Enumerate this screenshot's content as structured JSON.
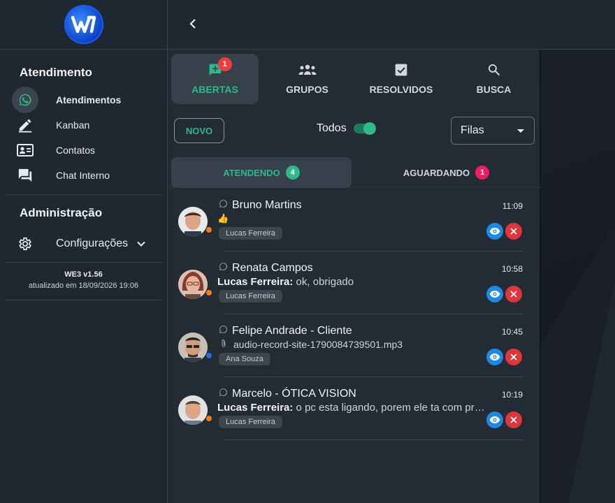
{
  "logo": {
    "text": "W"
  },
  "topbar": {
    "back_icon": "chevron-left-icon"
  },
  "sidebar": {
    "section1": "Atendimento",
    "items": [
      {
        "label": "Atendimentos",
        "icon": "whatsapp-icon",
        "active": true
      },
      {
        "label": "Kanban",
        "icon": "pencil-icon"
      },
      {
        "label": "Contatos",
        "icon": "contacts-card-icon"
      },
      {
        "label": "Chat Interno",
        "icon": "forum-icon"
      }
    ],
    "section2": "Administração",
    "settings": {
      "label": "Configurações",
      "icon": "gear-icon",
      "expand_icon": "chevron-down-icon"
    },
    "version": "WE3 v1.56",
    "updated": "atualizado em 18/09/2026 19:06"
  },
  "tabs": [
    {
      "label": "ABERTAS",
      "icon": "add-chat-icon",
      "badge": "1",
      "active": true
    },
    {
      "label": "GRUPOS",
      "icon": "groups-icon"
    },
    {
      "label": "RESOLVIDOS",
      "icon": "checkbox-icon"
    },
    {
      "label": "BUSCA",
      "icon": "search-icon"
    }
  ],
  "controls": {
    "novo": "NOVO",
    "toggle_label": "Todos",
    "toggle_on": true,
    "select_value": "Filas"
  },
  "subtabs": [
    {
      "label": "ATENDENDO",
      "count": "4",
      "active": true
    },
    {
      "label": "AGUARDANDO",
      "count": "1"
    }
  ],
  "tickets": [
    {
      "name": "Bruno Martins",
      "time": "11:09",
      "sender": "",
      "message": "👍",
      "tag": "Lucas Ferreira",
      "status_color": "#f07d1e",
      "avatar_bg": "#c99a80"
    },
    {
      "name": "Renata Campos",
      "time": "10:58",
      "sender": "Lucas Ferreira:",
      "message": " ok, obrigado",
      "tag": "Lucas Ferreira",
      "status_color": "#f07d1e",
      "avatar_bg": "#b07a6a"
    },
    {
      "name": "Felipe Andrade - Cliente",
      "time": "10:45",
      "sender": "",
      "message": "audio-record-site-1790084739501.mp3",
      "attachment": true,
      "tag": "Ana Souza",
      "status_color": "#1e6fe0",
      "avatar_bg": "#9c7a6a"
    },
    {
      "name": "Marcelo - ÓTICA VISION",
      "time": "10:19",
      "sender": "Lucas Ferreira:",
      "message": " o pc esta ligando, porem ele ta com problema",
      "tag": "Lucas Ferreira",
      "status_color": "#f07d1e",
      "avatar_bg": "#b58470"
    }
  ]
}
